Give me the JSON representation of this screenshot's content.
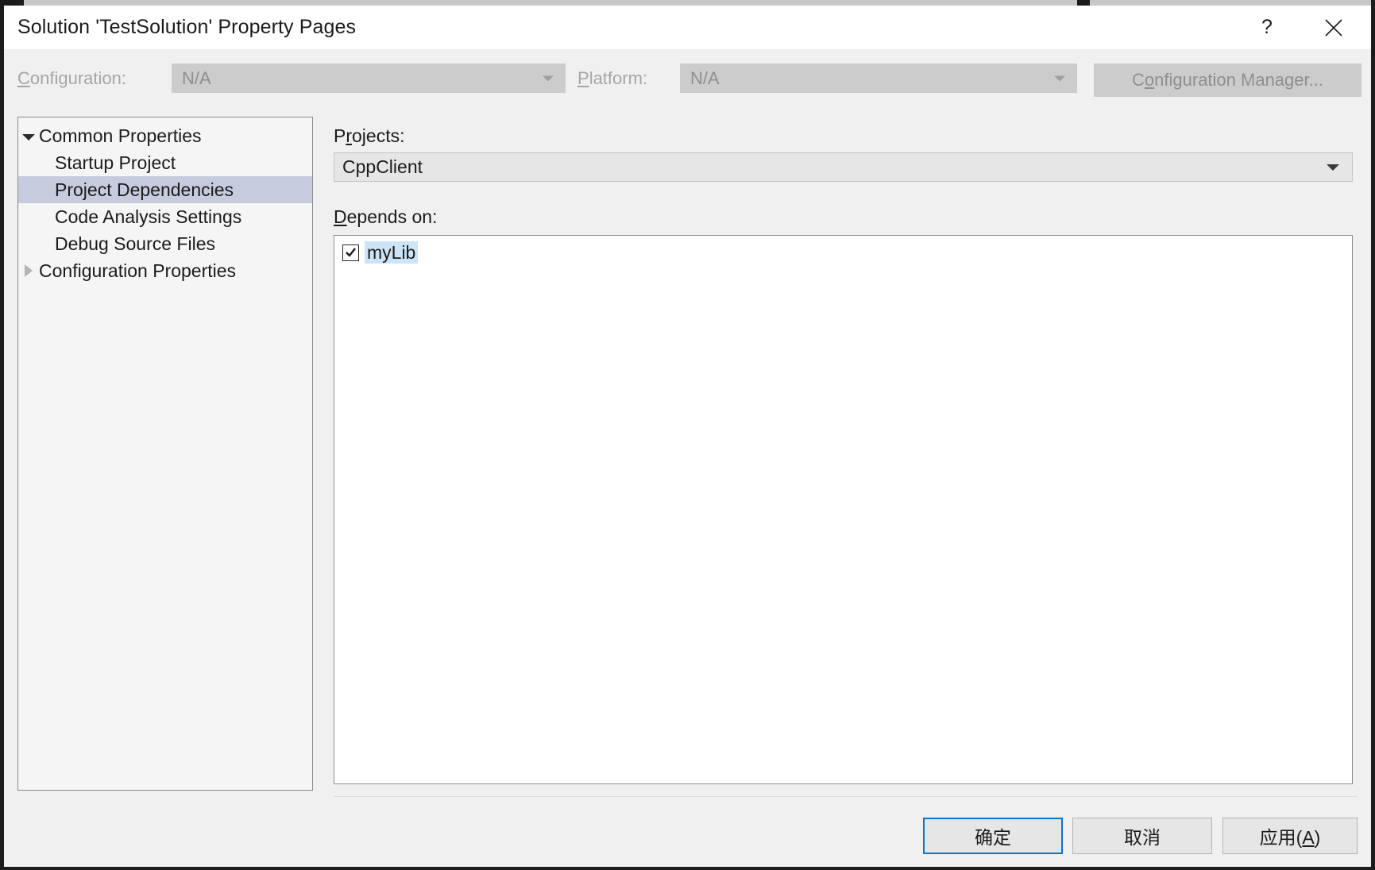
{
  "window": {
    "title": "Solution 'TestSolution' Property Pages",
    "help_label": "?",
    "help_icon": "question-mark-icon",
    "close_icon": "close-x-icon"
  },
  "toolbar": {
    "configuration": {
      "label_prefix": "",
      "label_accesskey": "C",
      "label_suffix": "onfiguration:",
      "value": "N/A",
      "enabled": false
    },
    "platform": {
      "label_accesskey": "P",
      "label_suffix": "latform:",
      "value": "N/A",
      "enabled": false
    },
    "configuration_manager": {
      "prefix": "C",
      "accesskey": "o",
      "suffix": "nfiguration Manager...",
      "enabled": false
    }
  },
  "tree": {
    "items": [
      {
        "label": "Common Properties",
        "level": 0,
        "state": "expanded",
        "selected": false
      },
      {
        "label": "Startup Project",
        "level": 1,
        "state": "leaf",
        "selected": false
      },
      {
        "label": "Project Dependencies",
        "level": 1,
        "state": "leaf",
        "selected": true
      },
      {
        "label": "Code Analysis Settings",
        "level": 1,
        "state": "leaf",
        "selected": false
      },
      {
        "label": "Debug Source Files",
        "level": 1,
        "state": "leaf",
        "selected": false
      },
      {
        "label": "Configuration Properties",
        "level": 0,
        "state": "collapsed",
        "selected": false
      }
    ]
  },
  "main": {
    "projects": {
      "label_prefix": "P",
      "label_accesskey": "r",
      "label_suffix": "ojects:",
      "selected_value": "CppClient",
      "options": [
        "CppClient"
      ]
    },
    "depends_on": {
      "label_accesskey": "D",
      "label_suffix": "epends on:",
      "items": [
        {
          "label": "myLib",
          "checked": true,
          "selected": true
        }
      ]
    }
  },
  "footer": {
    "ok_label": "确定",
    "cancel_label": "取消",
    "apply_prefix": "应用(",
    "apply_accesskey": "A",
    "apply_suffix": ")"
  },
  "colors": {
    "accent_focus": "#0078d7",
    "selection_tree": "#c6cbdd",
    "selection_list": "#cce4f7",
    "dialog_bg": "#f0f0f0",
    "disabled_text": "#8f8f8f"
  }
}
